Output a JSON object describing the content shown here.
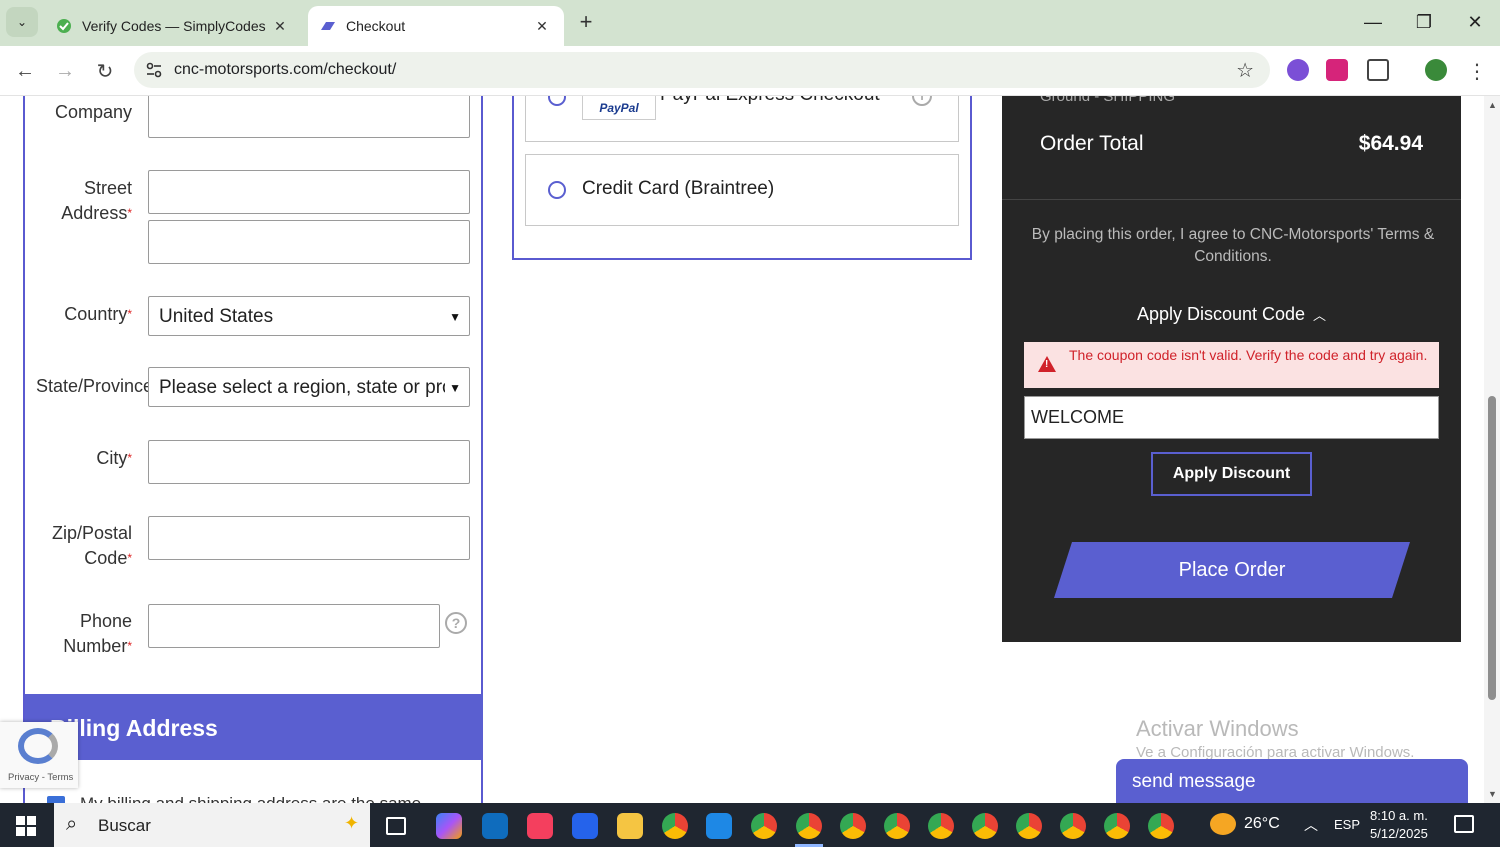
{
  "browser": {
    "tabs": [
      {
        "title": "Verify Codes — SimplyCodes",
        "active": false
      },
      {
        "title": "Checkout",
        "active": true
      }
    ],
    "url": "cnc-motorsports.com/checkout/"
  },
  "shipping_form": {
    "fields": {
      "company": {
        "label": "Company"
      },
      "street_line1": "Street",
      "street_line2": "Address",
      "country": {
        "label": "Country",
        "value": "United States"
      },
      "state": {
        "label": "State/Province",
        "value": "Please select a region, state or province."
      },
      "city": {
        "label": "City"
      },
      "zip_line1": "Zip/Postal",
      "zip_line2": "Code",
      "phone_line1": "Phone",
      "phone_line2": "Number"
    },
    "required_marker": "*",
    "help_glyph": "?"
  },
  "billing": {
    "title": "Billing Address",
    "same_as_shipping": "My billing and shipping address are the same"
  },
  "payment": {
    "options": [
      {
        "label": "PayPal Express Checkout",
        "logo_text": "PayPal"
      },
      {
        "label": "Credit Card (Braintree)"
      }
    ]
  },
  "summary": {
    "shipping_method": "Ground - SHIPPING",
    "order_total_label": "Order Total",
    "order_total_value": "$64.94",
    "agreement": "By placing this order, I agree to CNC-Motorsports' Terms & Conditions.",
    "discount_heading": "Apply Discount Code",
    "error_message": "The coupon code isn't valid. Verify the code and try again.",
    "coupon_value": "WELCOME",
    "apply_button": "Apply Discount",
    "place_order_button": "Place Order"
  },
  "recaptcha": {
    "links": "Privacy - Terms"
  },
  "watermark": {
    "line1": "Activar Windows",
    "line2": "Ve a Configuración para activar Windows."
  },
  "chat": {
    "label": "send message"
  },
  "taskbar": {
    "search_placeholder": "Buscar",
    "temperature": "26°C",
    "language": "ESP",
    "time": "8:10 a. m.",
    "date": "5/12/2025"
  },
  "colors": {
    "accent": "#5a5fd0",
    "error": "#d0222a",
    "summary_bg": "#262626"
  }
}
